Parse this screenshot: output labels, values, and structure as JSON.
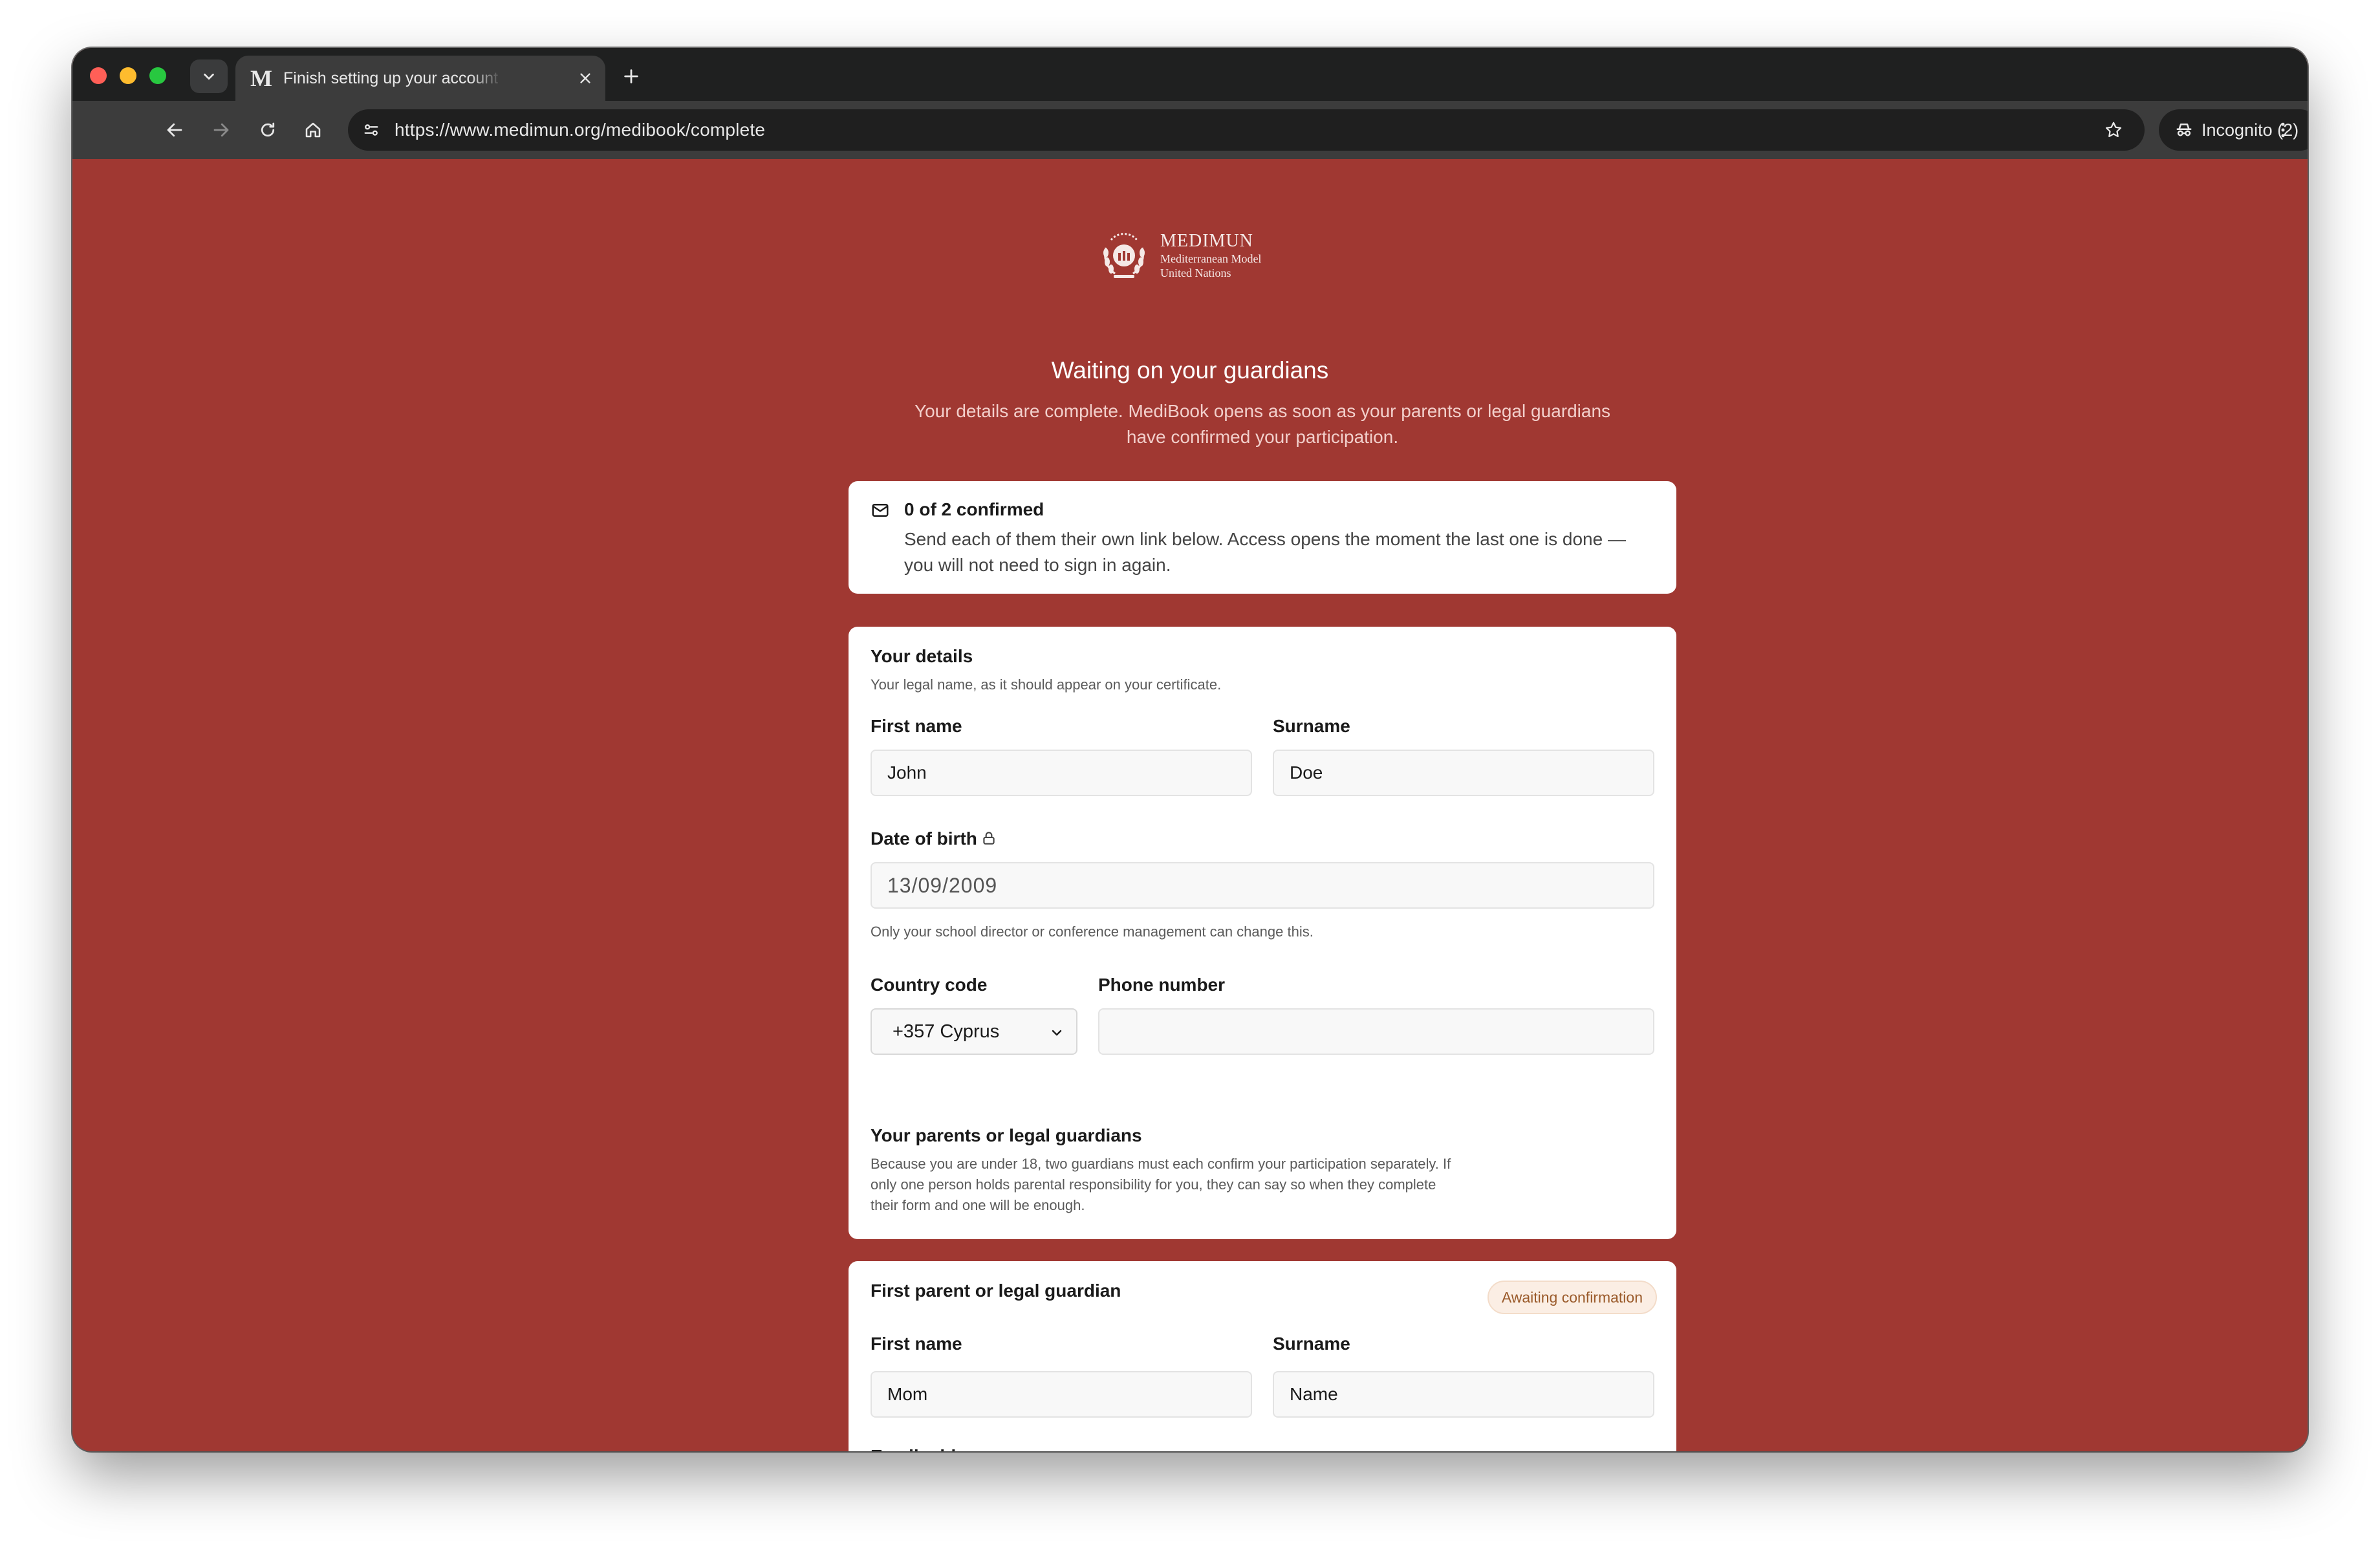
{
  "browser": {
    "tab_title": "Finish setting up your account",
    "url": "https://www.medimun.org/medibook/complete",
    "incognito_label": "Incognito (2)",
    "favicon_letter": "M"
  },
  "brand": {
    "name": "MEDIMUN",
    "sub_line1": "Mediterranean Model",
    "sub_line2": "United Nations",
    "bg_color": "#a03832"
  },
  "header": {
    "title": "Waiting on your guardians",
    "subtitle": "Your details are complete. MediBook opens as soon as your parents or legal guardians have confirmed your participation."
  },
  "status": {
    "title": "0 of 2 confirmed",
    "text": "Send each of them their own link below. Access opens the moment the last one is done — you will not need to sign in again.",
    "icon": "mail-icon"
  },
  "details": {
    "title": "Your details",
    "description": "Your legal name, as it should appear on your certificate.",
    "first_name_label": "First name",
    "first_name_value": "John",
    "surname_label": "Surname",
    "surname_value": "Doe",
    "dob_label": "Date of birth",
    "dob_value": "13/09/2009",
    "dob_note": "Only your school director or conference management can change this.",
    "country_code_label": "Country code",
    "country_code_value": "+357 Cyprus",
    "phone_label": "Phone number",
    "phone_value": ""
  },
  "guardians": {
    "title": "Your parents or legal guardians",
    "description": "Because you are under 18, two guardians must each confirm your participation separately. If only one person holds parental responsibility for you, they can say so when they complete their form and one will be enough."
  },
  "first_guardian": {
    "title": "First parent or legal guardian",
    "badge": "Awaiting confirmation",
    "first_name_label": "First name",
    "first_name_value": "Mom",
    "surname_label": "Surname",
    "surname_value": "Name",
    "email_label": "Email address"
  }
}
